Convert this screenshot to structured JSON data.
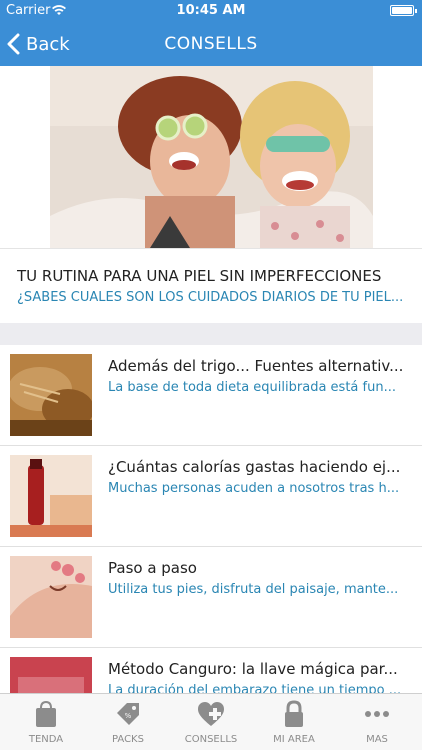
{
  "status_bar": {
    "carrier": "Carrier",
    "time": "10:45 AM"
  },
  "nav": {
    "back_label": "Back",
    "title": "CONSELLS"
  },
  "featured": {
    "title": "TU RUTINA PARA UNA PIEL SIN IMPERFECCIONES",
    "subtitle": "¿SABES CUALES SON LOS CUIDADOS DIARIOS DE TU PIEL..."
  },
  "articles": [
    {
      "title": "Además del trigo... Fuentes alternativ...",
      "summary": "La base de toda dieta equilibrada está fun..."
    },
    {
      "title": "¿Cuántas calorías gastas haciendo ej...",
      "summary": "Muchas personas acuden a nosotros tras h..."
    },
    {
      "title": "Paso a paso",
      "summary": "Utiliza tus pies, disfruta del paisaje, mante..."
    },
    {
      "title": "Método Canguro: la llave mágica par...",
      "summary": "La duración del embarazo tiene un tiempo ..."
    }
  ],
  "tabs": [
    {
      "label": "TENDA",
      "icon": "shopping-bag-icon"
    },
    {
      "label": "PACKS",
      "icon": "price-tag-icon"
    },
    {
      "label": "CONSELLS",
      "icon": "heart-plus-icon"
    },
    {
      "label": "MI AREA",
      "icon": "lock-icon"
    },
    {
      "label": "MAS",
      "icon": "more-dots-icon"
    }
  ],
  "colors": {
    "accent": "#3b8ed6",
    "link_text": "#2a86b3",
    "tab_inactive": "#8c8c8c"
  }
}
